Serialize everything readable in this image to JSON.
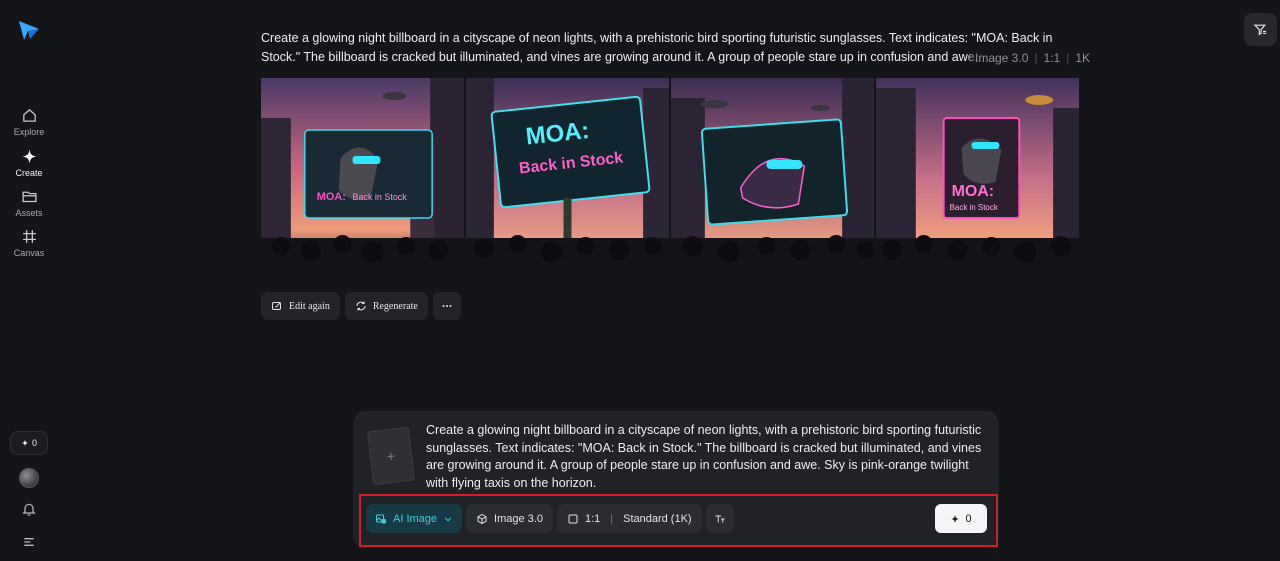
{
  "sidebar": {
    "items": [
      {
        "label": "Explore",
        "icon": "home-icon"
      },
      {
        "label": "Create",
        "icon": "diamond-sparkle-icon"
      },
      {
        "label": "Assets",
        "icon": "folder-icon"
      },
      {
        "label": "Canvas",
        "icon": "canvas-grid-icon"
      }
    ],
    "credits": "0"
  },
  "result": {
    "prompt": "Create a glowing night billboard in a cityscape of neon lights, with a prehistoric bird sporting futuristic sunglasses. Text indicates: \"MOA: Back in Stock.\" The billboard is cracked but illuminated, and vines are growing around it. A group of people stare up in confusion and awe. Sky is pink-orange twilight with flying taxis on the horizon.",
    "meta": {
      "model": "Image 3.0",
      "ratio": "1:1",
      "resolution": "1K"
    },
    "images": [
      {
        "billboard_text_1": "MOA:",
        "billboard_text_2": "Back in Stock"
      },
      {
        "billboard_text_1": "MOA:",
        "billboard_text_2": "Back in Stock"
      },
      {
        "billboard_text_1": "",
        "billboard_text_2": ""
      },
      {
        "billboard_text_1": "MOA:",
        "billboard_text_2": "Back in Stock"
      }
    ],
    "actions": {
      "edit_again": "Edit again",
      "regenerate": "Regenerate"
    }
  },
  "composer": {
    "prompt": "Create a glowing night billboard in a cityscape of neon lights, with a prehistoric bird sporting futuristic sunglasses. Text indicates: \"MOA: Back in Stock.\" The billboard is cracked but illuminated, and vines are growing around it. A group of people stare up in confusion and awe. Sky is pink-orange twilight with flying taxis on the horizon.",
    "reference_placeholder": "+",
    "mode_label": "AI Image",
    "model_label": "Image 3.0",
    "ratio_label": "1:1",
    "quality_label": "Standard (1K)",
    "generate_cost": "0"
  },
  "colors": {
    "background": "#141518",
    "accent": "#3ecbe0",
    "highlight": "#d11f2a",
    "neon_pink": "#ff3fb4",
    "neon_cyan": "#33e4ff"
  }
}
